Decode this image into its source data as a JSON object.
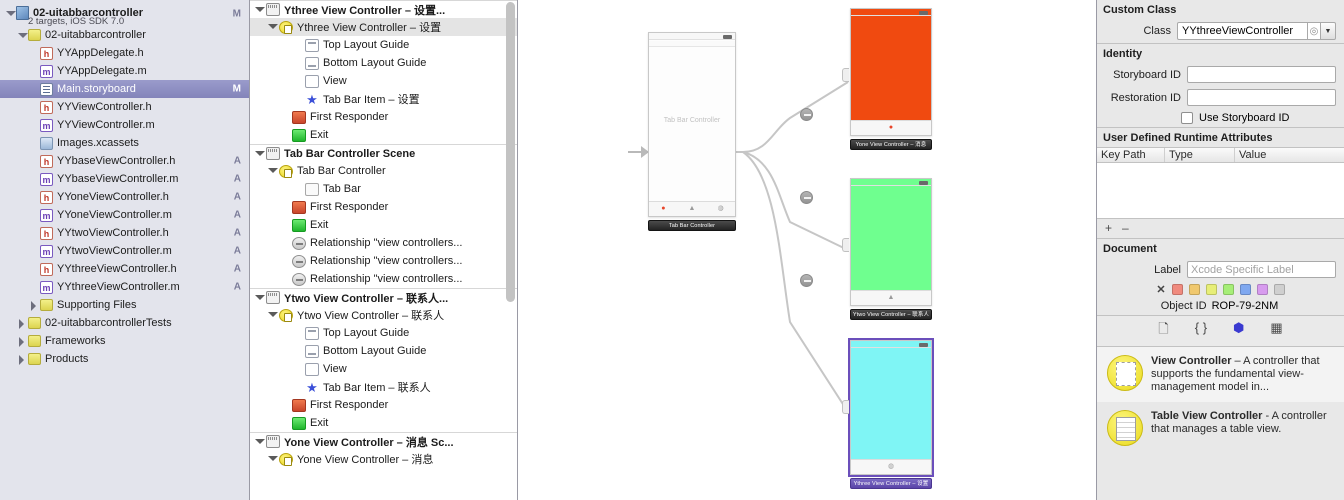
{
  "navigator": {
    "project": {
      "name": "02-uitabbarcontroller",
      "subtitle": "2 targets, iOS SDK 7.0",
      "status": "M"
    },
    "items": [
      {
        "label": "02-uitabbarcontroller",
        "icon": "folder-icon",
        "indent": 1,
        "disclosure": "open",
        "status": ""
      },
      {
        "label": "YYAppDelegate.h",
        "icon": "header-file-icon",
        "indent": 2,
        "disclosure": "",
        "status": ""
      },
      {
        "label": "YYAppDelegate.m",
        "icon": "implementation-file-icon",
        "indent": 2,
        "disclosure": "",
        "status": ""
      },
      {
        "label": "Main.storyboard",
        "icon": "storyboard-file-icon",
        "indent": 2,
        "disclosure": "",
        "status": "M",
        "selected": true
      },
      {
        "label": "YYViewController.h",
        "icon": "header-file-icon",
        "indent": 2,
        "disclosure": "",
        "status": ""
      },
      {
        "label": "YYViewController.m",
        "icon": "implementation-file-icon",
        "indent": 2,
        "disclosure": "",
        "status": ""
      },
      {
        "label": "Images.xcassets",
        "icon": "asset-catalog-icon",
        "indent": 2,
        "disclosure": "",
        "status": ""
      },
      {
        "label": "YYbaseViewController.h",
        "icon": "header-file-icon",
        "indent": 2,
        "disclosure": "",
        "status": "A"
      },
      {
        "label": "YYbaseViewController.m",
        "icon": "implementation-file-icon",
        "indent": 2,
        "disclosure": "",
        "status": "A"
      },
      {
        "label": "YYoneViewController.h",
        "icon": "header-file-icon",
        "indent": 2,
        "disclosure": "",
        "status": "A"
      },
      {
        "label": "YYoneViewController.m",
        "icon": "implementation-file-icon",
        "indent": 2,
        "disclosure": "",
        "status": "A"
      },
      {
        "label": "YYtwoViewController.h",
        "icon": "header-file-icon",
        "indent": 2,
        "disclosure": "",
        "status": "A"
      },
      {
        "label": "YYtwoViewController.m",
        "icon": "implementation-file-icon",
        "indent": 2,
        "disclosure": "",
        "status": "A"
      },
      {
        "label": "YYthreeViewController.h",
        "icon": "header-file-icon",
        "indent": 2,
        "disclosure": "",
        "status": "A"
      },
      {
        "label": "YYthreeViewController.m",
        "icon": "implementation-file-icon",
        "indent": 2,
        "disclosure": "",
        "status": "A"
      },
      {
        "label": "Supporting Files",
        "icon": "folder-icon",
        "indent": 2,
        "disclosure": "closed",
        "status": ""
      },
      {
        "label": "02-uitabbarcontrollerTests",
        "icon": "folder-icon",
        "indent": 1,
        "disclosure": "closed",
        "status": ""
      },
      {
        "label": "Frameworks",
        "icon": "folder-icon",
        "indent": 1,
        "disclosure": "closed",
        "status": ""
      },
      {
        "label": "Products",
        "icon": "folder-icon",
        "indent": 1,
        "disclosure": "closed",
        "status": ""
      }
    ]
  },
  "outline": {
    "rows": [
      {
        "label": "Ythree View Controller – 设置...",
        "icon": "scene-icon",
        "indent": 0,
        "disclosure": "open",
        "kind": "scene"
      },
      {
        "label": "Ythree View Controller – 设置",
        "icon": "view-controller-icon",
        "indent": 1,
        "disclosure": "open",
        "selected": true
      },
      {
        "label": "Top Layout Guide",
        "icon": "top-layout-guide-icon",
        "indent": 3,
        "disclosure": ""
      },
      {
        "label": "Bottom Layout Guide",
        "icon": "bottom-layout-guide-icon",
        "indent": 3,
        "disclosure": ""
      },
      {
        "label": "View",
        "icon": "view-icon",
        "indent": 3,
        "disclosure": ""
      },
      {
        "label": "Tab Bar Item – 设置",
        "icon": "tab-bar-item-icon",
        "indent": 3,
        "disclosure": ""
      },
      {
        "label": "First Responder",
        "icon": "first-responder-icon",
        "indent": 2,
        "disclosure": ""
      },
      {
        "label": "Exit",
        "icon": "exit-icon",
        "indent": 2,
        "disclosure": ""
      },
      {
        "label": "Tab Bar Controller Scene",
        "icon": "scene-icon",
        "indent": 0,
        "disclosure": "open",
        "kind": "scene"
      },
      {
        "label": "Tab Bar Controller",
        "icon": "view-controller-icon",
        "indent": 1,
        "disclosure": "open"
      },
      {
        "label": "Tab Bar",
        "icon": "tab-bar-icon",
        "indent": 3,
        "disclosure": ""
      },
      {
        "label": "First Responder",
        "icon": "first-responder-icon",
        "indent": 2,
        "disclosure": ""
      },
      {
        "label": "Exit",
        "icon": "exit-icon",
        "indent": 2,
        "disclosure": ""
      },
      {
        "label": "Relationship \"view controllers...",
        "icon": "relationship-icon",
        "indent": 2,
        "disclosure": ""
      },
      {
        "label": "Relationship \"view controllers...",
        "icon": "relationship-icon",
        "indent": 2,
        "disclosure": ""
      },
      {
        "label": "Relationship \"view controllers...",
        "icon": "relationship-icon",
        "indent": 2,
        "disclosure": ""
      },
      {
        "label": "Ytwo View Controller – 联系人...",
        "icon": "scene-icon",
        "indent": 0,
        "disclosure": "open",
        "kind": "scene"
      },
      {
        "label": "Ytwo View Controller – 联系人",
        "icon": "view-controller-icon",
        "indent": 1,
        "disclosure": "open"
      },
      {
        "label": "Top Layout Guide",
        "icon": "top-layout-guide-icon",
        "indent": 3,
        "disclosure": ""
      },
      {
        "label": "Bottom Layout Guide",
        "icon": "bottom-layout-guide-icon",
        "indent": 3,
        "disclosure": ""
      },
      {
        "label": "View",
        "icon": "view-icon",
        "indent": 3,
        "disclosure": ""
      },
      {
        "label": "Tab Bar Item – 联系人",
        "icon": "tab-bar-item-icon",
        "indent": 3,
        "disclosure": ""
      },
      {
        "label": "First Responder",
        "icon": "first-responder-icon",
        "indent": 2,
        "disclosure": ""
      },
      {
        "label": "Exit",
        "icon": "exit-icon",
        "indent": 2,
        "disclosure": ""
      },
      {
        "label": "Yone View Controller – 消息 Sc...",
        "icon": "scene-icon",
        "indent": 0,
        "disclosure": "open",
        "kind": "scene"
      },
      {
        "label": "Yone View Controller – 消息",
        "icon": "view-controller-icon",
        "indent": 1,
        "disclosure": "open"
      }
    ]
  },
  "canvas": {
    "tab_bar_controller": {
      "placeholder": "Tab Bar Controller",
      "title": "Tab Bar Controller",
      "tab_items": [
        "●",
        "▲",
        "◍"
      ]
    },
    "scenes": [
      {
        "title": "Yone View Controller – 消息",
        "color": "#F04A10",
        "selected": false
      },
      {
        "title": "Ytwo View Controller – 联系人",
        "color": "#6FFF8F",
        "selected": false
      },
      {
        "title": "Ythree View Controller – 设置",
        "color": "#7FF5F5",
        "selected": true
      }
    ]
  },
  "inspector": {
    "custom_class": {
      "section": "Custom Class",
      "class_label": "Class",
      "class_value": "YYthreeViewController"
    },
    "identity": {
      "section": "Identity",
      "storyboard_id_label": "Storyboard ID",
      "storyboard_id_value": "",
      "restoration_id_label": "Restoration ID",
      "restoration_id_value": "",
      "use_storyboard_id_label": "Use Storyboard ID"
    },
    "runtime_attributes": {
      "section": "User Defined Runtime Attributes",
      "columns": [
        "Key Path",
        "Type",
        "Value"
      ],
      "add_label": "+",
      "remove_label": "–"
    },
    "document": {
      "section": "Document",
      "label_label": "Label",
      "label_placeholder": "Xcode Specific Label",
      "object_id_label": "Object ID",
      "object_id_value": "ROP-79-2NM",
      "swatch_none": "✕",
      "swatches": [
        "#F08A7E",
        "#F0C86E",
        "#E7EE77",
        "#A6EE77",
        "#7FA8F0",
        "#D79BEE",
        "#CFCFCF"
      ]
    },
    "library_tabs": [
      {
        "icon": "file-template-icon",
        "active": false
      },
      {
        "icon": "code-snippet-icon",
        "active": false
      },
      {
        "icon": "object-library-icon",
        "active": true
      },
      {
        "icon": "media-library-icon",
        "active": false
      }
    ],
    "library_items": [
      {
        "title": "View Controller",
        "description": " – A controller that supports the fundamental view-management model in...",
        "icon": "view-controller-library-icon"
      },
      {
        "title": "Table View Controller",
        "description": " - A controller that manages a table view.",
        "icon": "table-view-controller-library-icon"
      }
    ]
  }
}
